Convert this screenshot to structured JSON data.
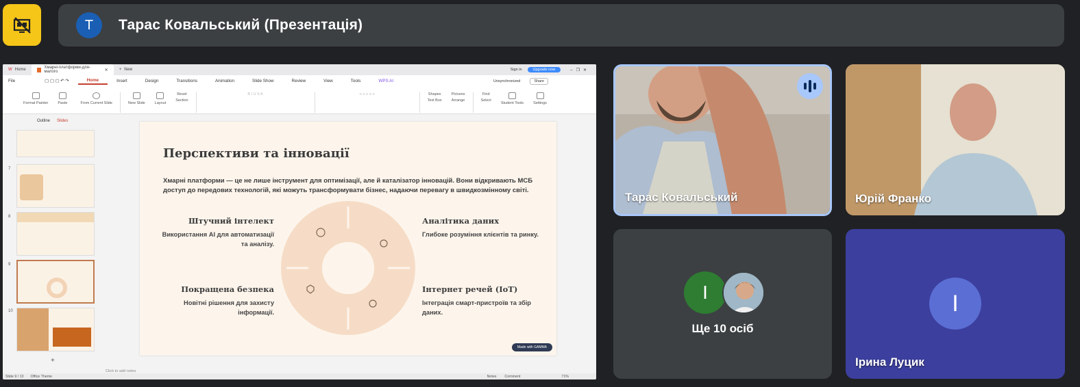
{
  "meet": {
    "presentation_title": "Тарас Ковальський (Презентація)",
    "presenter_initial": "Т",
    "participants": [
      {
        "name": "Тарас Ковальський",
        "speaking": true
      },
      {
        "name": "Юрій Франко"
      },
      {
        "name": "Ірина Луцик",
        "initial": "І"
      }
    ],
    "others": {
      "label": "Ще 10 осіб",
      "initial": "І"
    },
    "colors": {
      "accent": "#f5c518",
      "bg": "#202124",
      "tile": "#3c4043",
      "iryna_tile": "#3c3f9e",
      "speaking_border": "#a8c7fa"
    }
  },
  "wps": {
    "tabs": {
      "home": "Home",
      "doc": "Хмарні-платформи-для-малого",
      "new": "New"
    },
    "topright": {
      "signin": "Sign in",
      "upgrade": "Upgrade now"
    },
    "menus": [
      "File",
      "Home",
      "Insert",
      "Design",
      "Transitions",
      "Animation",
      "Slide Show",
      "Review",
      "View",
      "Tools",
      "WPS AI"
    ],
    "unsync": "Unsynchronized",
    "share": "Share",
    "ribbon": {
      "format_painter": "Format Painter",
      "paste": "Paste",
      "from_current": "From Current Slide",
      "new_slide": "New Slide",
      "layout": "Layout",
      "reset": "Reset",
      "section": "Section",
      "shapes": "Shapes",
      "pictures": "Pictures",
      "textbox": "Text Box",
      "arrange": "Arrange",
      "find": "Find",
      "select": "Select",
      "student_tools": "Student Tools",
      "settings": "Settings"
    },
    "panel_tabs": {
      "outline": "Outline",
      "slides": "Slides"
    },
    "slide_numbers": [
      "7",
      "8",
      "9",
      "10"
    ],
    "notes_placeholder": "Click to add notes",
    "status": {
      "slide": "Slide 9 / 13",
      "theme": "Office Theme",
      "notes": "Notes",
      "comment": "Comment",
      "zoom": "71%"
    }
  },
  "slide": {
    "title": "Перспективи та інновації",
    "intro": "Хмарні платформи — це не лише інструмент для оптимізації, але й каталізатор інновацій. Вони відкривають МСБ доступ до передових технологій, які можуть трансформувати бізнес, надаючи перевагу в швидкозмінному світі.",
    "items": {
      "ai": {
        "title": "Штучний інтелект",
        "text": "Використання AI для автоматизації та аналізу."
      },
      "analytics": {
        "title": "Аналітика даних",
        "text": "Глибоке розуміння клієнтів та ринку."
      },
      "security": {
        "title": "Покращена безпека",
        "text": "Новітні рішення для захисту інформації."
      },
      "iot": {
        "title": "Інтернет речей (IoT)",
        "text": "Інтеграція смарт-пристроїв та збір даних."
      }
    },
    "made_with": "Made with GAMMA"
  }
}
